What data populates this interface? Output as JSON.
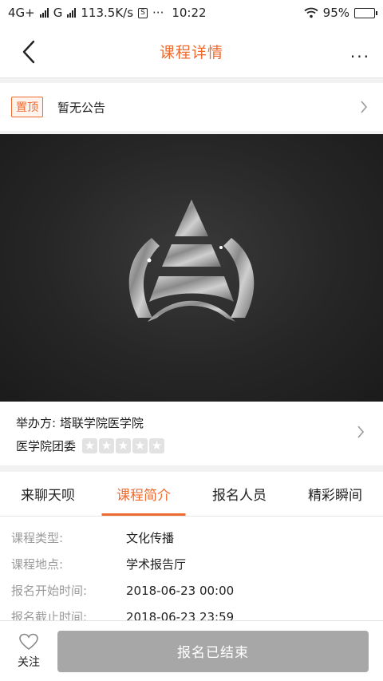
{
  "status_bar": {
    "network1": "4G+",
    "network2": "G",
    "speed": "113.5K/s",
    "dots": "···",
    "time": "10:22",
    "battery": "95%",
    "battery_level": 0.95
  },
  "header": {
    "title": "课程详情",
    "more": "...",
    "back_icon": "chevron-left-icon"
  },
  "notice": {
    "badge": "置顶",
    "text": "暂无公告"
  },
  "organizer": {
    "line1": "举办方:  塔联学院医学院",
    "line2": "医学院团委",
    "rating": 0,
    "rating_max": 5
  },
  "tabs": [
    {
      "label": "来聊天呗"
    },
    {
      "label": "课程简介"
    },
    {
      "label": "报名人员"
    },
    {
      "label": "精彩瞬间"
    }
  ],
  "active_tab": 1,
  "details": [
    {
      "key": "课程类型:",
      "value": "文化传播"
    },
    {
      "key": "课程地点:",
      "value": "学术报告厅"
    },
    {
      "key": "报名开始时间:",
      "value": "2018-06-23 00:00"
    },
    {
      "key": "报名截止时间:",
      "value": "2018-06-23 23:59"
    }
  ],
  "footer": {
    "follow_label": "关注",
    "enroll_label": "报名已结束"
  },
  "colors": {
    "accent": "#ee6a2f",
    "disabled_button": "#a7a7a7"
  }
}
